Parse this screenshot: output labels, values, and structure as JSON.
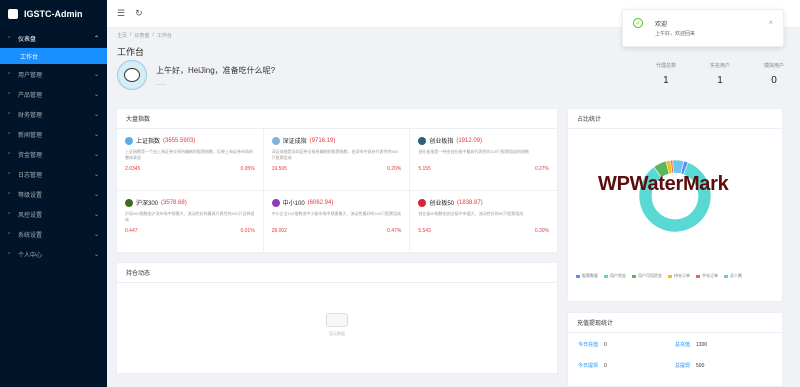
{
  "app": {
    "title": "IGSTC-Admin"
  },
  "sidebar": {
    "items": [
      {
        "label": "仪表盘",
        "icon": "dashboard-icon",
        "open": true,
        "arrow": "⌃"
      },
      {
        "label": "工作台",
        "sub": true
      },
      {
        "label": "用户管理",
        "icon": "user-icon",
        "arrow": "⌄"
      },
      {
        "label": "产品管理",
        "icon": "box-icon",
        "arrow": "⌄"
      },
      {
        "label": "财务管理",
        "icon": "wallet-icon",
        "arrow": "⌄"
      },
      {
        "label": "新闻管理",
        "icon": "news-icon",
        "arrow": "⌄"
      },
      {
        "label": "资金管理",
        "icon": "money-icon",
        "arrow": "⌄"
      },
      {
        "label": "日志管理",
        "icon": "log-icon",
        "arrow": "⌄"
      },
      {
        "label": "等级设置",
        "icon": "level-icon",
        "arrow": "⌄"
      },
      {
        "label": "风控设置",
        "icon": "shield-icon",
        "arrow": "⌄"
      },
      {
        "label": "系统设置",
        "icon": "gear-icon",
        "arrow": "⌄"
      },
      {
        "label": "个人中心",
        "icon": "person-icon",
        "arrow": "⌄"
      }
    ]
  },
  "breadcrumb": [
    "主页",
    "/",
    "仪表盘",
    "/",
    "工作台"
  ],
  "page": {
    "title": "工作台"
  },
  "welcome": {
    "greeting": "上午好，HeiJing，准备吃什么呢?",
    "sub": "——"
  },
  "stats": [
    {
      "label": "代理总数",
      "value": "1"
    },
    {
      "label": "实名用户",
      "value": "1"
    },
    {
      "label": "模拟用户",
      "value": "0"
    }
  ],
  "indices": {
    "title": "大盘指数",
    "cards": [
      {
        "name": "上证指数",
        "value": "(3655.5903)",
        "color": "#5aaee8",
        "desc": "上证指数是一个由上海证券交易所编制的股票指数，反映上海证券市场的整体表现",
        "change": "2.0345",
        "pct": "0.05%"
      },
      {
        "name": "深证成指",
        "value": "(9716.19)",
        "color": "#7fb3de",
        "desc": "深证成指是深圳证券交易所编制的股票指数，由深市中具有代表性的500只股票组成",
        "change": "19.505",
        "pct": "0.20%"
      },
      {
        "name": "创业板指",
        "value": "(1912.09)",
        "color": "#2d5e7a",
        "desc": "创业板指是一种由创业板中最具代表性的100只股票组成的指数",
        "change": "5.155",
        "pct": "0.27%"
      },
      {
        "name": "沪深300",
        "value": "(3578.68)",
        "color": "#3b6e1f",
        "desc": "沪深300指数由沪深市场中规模大、流动性好的最具代表性的300只证券组成",
        "change": "0.447",
        "pct": "0.01%"
      },
      {
        "name": "中小100",
        "value": "(6062.94)",
        "color": "#8e3bb5",
        "desc": "中小企业100指数由中小板市场中规模最大、流动性最好的100只股票组成",
        "change": "28.002",
        "pct": "0.47%"
      },
      {
        "name": "创业板50",
        "value": "(1838.87)",
        "color": "#d8233f",
        "desc": "创业板50指数由创业板中市值大、流动性好的50只股票组成",
        "change": "5.543",
        "pct": "0.30%"
      }
    ]
  },
  "dynamics": {
    "title": "持仓动态",
    "empty_text": "暂无数据"
  },
  "ratio": {
    "title": "占比统计",
    "legend": [
      {
        "label": "股票数量",
        "color": "#5b8ff9"
      },
      {
        "label": "用户资金",
        "color": "#5ad8d4"
      },
      {
        "label": "用户可用资金",
        "color": "#5ab85a"
      },
      {
        "label": "持仓订单",
        "color": "#f6bd16"
      },
      {
        "label": "平仓订单",
        "color": "#e8684a"
      },
      {
        "label": "总人数",
        "color": "#6dc8ec"
      }
    ],
    "slices": [
      2,
      84,
      6,
      2,
      1,
      5
    ]
  },
  "watermark": "WPWaterMark",
  "recharge": {
    "title": "充值提现统计",
    "items": [
      {
        "label": "今日充值",
        "value": "0"
      },
      {
        "label": "总充值",
        "value": "1300"
      },
      {
        "label": "今日提现",
        "value": "0"
      },
      {
        "label": "总提现",
        "value": "500"
      }
    ]
  },
  "toast": {
    "title": "欢迎",
    "message": "上午好，欢迎回来",
    "close": "×",
    "icon": "✓"
  },
  "header": {
    "collapse": "☰",
    "refresh": "↻"
  }
}
